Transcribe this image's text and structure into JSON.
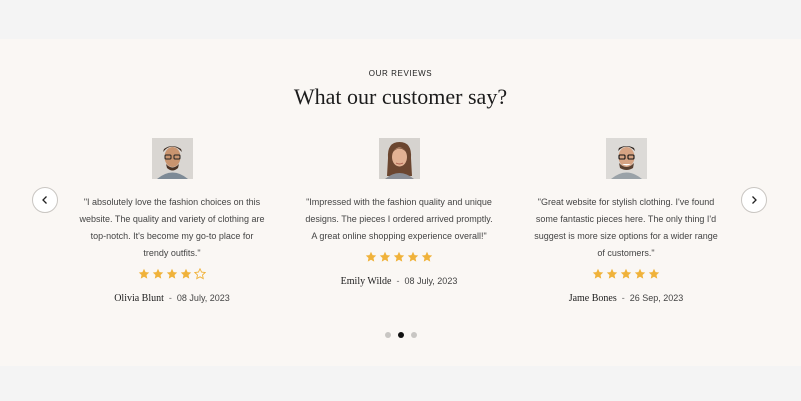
{
  "section": {
    "eyebrow": "OUR REVIEWS",
    "title": "What our customer say?"
  },
  "colors": {
    "star": "#f0b23a",
    "background": "#faf7f4",
    "outer": "#f4f4f4"
  },
  "reviews": [
    {
      "quote": "\"I absolutely love the fashion choices on this website. The quality and variety of clothing are top-notch. It's become my go-to place for trendy outfits.\"",
      "rating": 4,
      "name": "Olivia Blunt",
      "date": "08 July, 2023"
    },
    {
      "quote": "\"Impressed with the fashion quality and unique designs. The pieces I ordered arrived promptly. A great online shopping experience overall!\"",
      "rating": 5,
      "name": "Emily Wilde",
      "date": "08 July, 2023"
    },
    {
      "quote": "\"Great website for stylish clothing. I've found some fantastic pieces here. The only thing I'd suggest is more size options for a wider range of customers.\"",
      "rating": 5,
      "name": "Jame Bones",
      "date": "26 Sep, 2023"
    }
  ],
  "separator": "-",
  "pagination": {
    "total": 3,
    "active": 2
  },
  "icons": {
    "prev": "chevron-left-icon",
    "next": "chevron-right-icon",
    "star": "star-icon"
  }
}
